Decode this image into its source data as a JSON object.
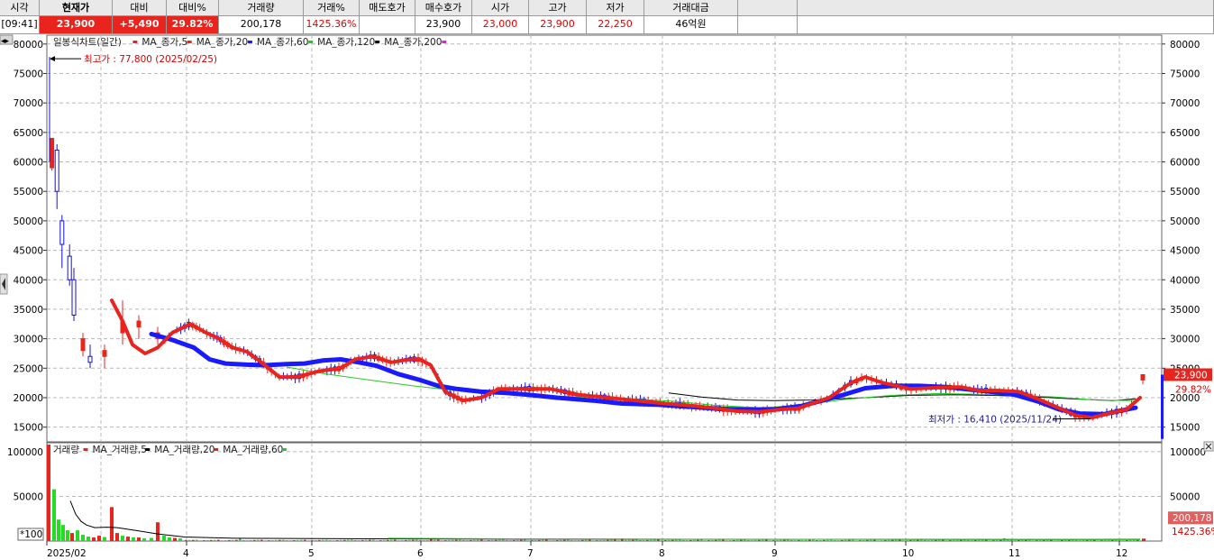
{
  "quote_header": {
    "labels": [
      "시각",
      "현재가",
      "대비",
      "대비%",
      "거래량",
      "거래%",
      "매도호가",
      "매수호가",
      "시가",
      "고가",
      "저가",
      "거래대금"
    ],
    "values": [
      "[09:41]",
      "23,900",
      "+5,490",
      "29.82%",
      "200,178",
      "1425.36%",
      "",
      "23,900",
      "23,000",
      "23,900",
      "22,250",
      "46억원"
    ]
  },
  "price_panel": {
    "legend": [
      "일봉식차트(일간)",
      "MA_종가,5",
      "MA_종가,20",
      "MA_종가,60",
      "MA_종가,120",
      "MA_종가,200"
    ],
    "high_annotation": "최고가 : 77,800 (2025/02/25)",
    "low_annotation": "최저가 : 16,410 (2025/11/24)",
    "price_tag": "23,900",
    "pct_tag": "29.82%",
    "expand_glyph": "◂▸"
  },
  "volume_panel": {
    "legend": [
      "거래량",
      "MA_거래량,5",
      "MA_거래량,20",
      "MA_거래량,60"
    ],
    "volume_tag": "200,178",
    "pct_tag": "1425.36%",
    "scale_label": "*100"
  },
  "colors": {
    "up": "#e8241c",
    "down": "#1010e0",
    "ma5": "#e8241c",
    "ma20": "#1a1aff",
    "ma120": "#22cc22",
    "ma200": "#000000",
    "vol_up": "#e8241c",
    "vol_down": "#22dd22"
  },
  "chart_data": {
    "type": "candlestick",
    "price_axis": {
      "ticks": [
        15000,
        20000,
        25000,
        30000,
        35000,
        40000,
        45000,
        50000,
        55000,
        60000,
        65000,
        70000,
        75000,
        80000
      ],
      "ylim": [
        12500,
        81500
      ]
    },
    "volume_axis": {
      "ticks": [
        50000,
        100000
      ],
      "ylim": [
        0,
        110000
      ]
    },
    "x_labels": [
      "2025/02",
      "4",
      "5",
      "6",
      "7",
      "8",
      "9",
      "10",
      "11",
      "12"
    ],
    "ma20_series": [
      [
        3.3,
        36500
      ],
      [
        3.45,
        33000
      ],
      [
        3.6,
        29000
      ],
      [
        3.8,
        27500
      ],
      [
        4.0,
        28500
      ],
      [
        4.2,
        31000
      ],
      [
        4.45,
        32500
      ],
      [
        4.7,
        31000
      ],
      [
        4.9,
        30000
      ],
      [
        5.1,
        28500
      ],
      [
        5.3,
        27800
      ],
      [
        5.5,
        26000
      ],
      [
        5.75,
        23500
      ],
      [
        6.0,
        23500
      ],
      [
        6.3,
        24500
      ],
      [
        6.6,
        25000
      ],
      [
        6.8,
        26500
      ],
      [
        7.05,
        27000
      ],
      [
        7.3,
        26000
      ],
      [
        7.55,
        26500
      ],
      [
        7.7,
        26500
      ],
      [
        7.85,
        25500
      ],
      [
        8.05,
        21000
      ],
      [
        8.3,
        19500
      ],
      [
        8.55,
        20000
      ],
      [
        8.8,
        21500
      ],
      [
        9.1,
        21500
      ],
      [
        9.5,
        21500
      ],
      [
        9.9,
        20500
      ],
      [
        10.3,
        20000
      ],
      [
        10.7,
        19500
      ],
      [
        11.1,
        19000
      ],
      [
        11.5,
        18600
      ],
      [
        11.8,
        18200
      ],
      [
        12.1,
        17700
      ],
      [
        12.4,
        17600
      ],
      [
        12.7,
        18000
      ],
      [
        12.95,
        18200
      ],
      [
        13.25,
        20000
      ],
      [
        13.45,
        22500
      ],
      [
        13.6,
        23500
      ],
      [
        13.8,
        22500
      ],
      [
        14.1,
        21500
      ],
      [
        14.4,
        21700
      ],
      [
        14.7,
        21800
      ],
      [
        14.95,
        21200
      ],
      [
        15.2,
        21200
      ],
      [
        15.45,
        21000
      ],
      [
        15.7,
        19700
      ],
      [
        15.95,
        18200
      ],
      [
        16.15,
        17000
      ],
      [
        16.35,
        16600
      ],
      [
        16.55,
        17300
      ],
      [
        16.75,
        18000
      ],
      [
        16.9,
        20000
      ]
    ],
    "ma60_series": [
      [
        3.9,
        30800
      ],
      [
        4.2,
        29800
      ],
      [
        4.5,
        28500
      ],
      [
        4.75,
        26500
      ],
      [
        5.0,
        25800
      ],
      [
        5.3,
        25600
      ],
      [
        5.55,
        25500
      ],
      [
        5.85,
        25700
      ],
      [
        6.1,
        25800
      ],
      [
        6.35,
        26300
      ],
      [
        6.6,
        26500
      ],
      [
        6.85,
        26000
      ],
      [
        7.1,
        25400
      ],
      [
        7.4,
        24000
      ],
      [
        7.7,
        23000
      ],
      [
        7.95,
        22000
      ],
      [
        8.2,
        21500
      ],
      [
        8.55,
        21000
      ],
      [
        8.9,
        20800
      ],
      [
        9.2,
        20500
      ],
      [
        9.6,
        20000
      ],
      [
        10.1,
        19500
      ],
      [
        10.5,
        19000
      ],
      [
        11.0,
        18800
      ],
      [
        11.5,
        18400
      ],
      [
        11.85,
        18100
      ],
      [
        12.2,
        18000
      ],
      [
        12.6,
        18000
      ],
      [
        13.0,
        18600
      ],
      [
        13.35,
        20300
      ],
      [
        13.6,
        21600
      ],
      [
        13.9,
        22000
      ],
      [
        14.2,
        22000
      ],
      [
        14.5,
        21800
      ],
      [
        14.8,
        21400
      ],
      [
        15.1,
        21000
      ],
      [
        15.4,
        20500
      ],
      [
        15.7,
        19300
      ],
      [
        15.95,
        18000
      ],
      [
        16.2,
        17300
      ],
      [
        16.5,
        17200
      ],
      [
        16.75,
        18000
      ],
      [
        16.85,
        18300
      ]
    ],
    "ma120_series": [
      [
        5.85,
        25200
      ],
      [
        6.4,
        24000
      ],
      [
        7.0,
        23000
      ],
      [
        7.6,
        22000
      ],
      [
        8.2,
        21200
      ],
      [
        8.8,
        20700
      ],
      [
        9.4,
        20300
      ],
      [
        10.0,
        20100
      ],
      [
        10.6,
        19800
      ],
      [
        11.2,
        19400
      ],
      [
        11.8,
        18700
      ],
      [
        12.4,
        18300
      ],
      [
        12.9,
        18600
      ],
      [
        13.4,
        19700
      ],
      [
        13.9,
        20400
      ],
      [
        14.4,
        20700
      ],
      [
        14.9,
        20600
      ],
      [
        15.4,
        20400
      ],
      [
        15.9,
        20100
      ],
      [
        16.4,
        19600
      ],
      [
        16.85,
        19500
      ]
    ],
    "ma200_series": [
      [
        11.15,
        20800
      ],
      [
        11.6,
        20100
      ],
      [
        12.1,
        19600
      ],
      [
        12.6,
        19500
      ],
      [
        13.1,
        19600
      ],
      [
        13.6,
        20000
      ],
      [
        14.1,
        20400
      ],
      [
        14.6,
        20500
      ],
      [
        15.1,
        20400
      ],
      [
        15.6,
        20200
      ],
      [
        16.1,
        19800
      ],
      [
        16.6,
        19500
      ],
      [
        16.85,
        19800
      ]
    ],
    "candles_sample": [
      [
        2.1,
        59000,
        64000,
        58500,
        64000
      ],
      [
        2.2,
        62000,
        63000,
        52000,
        55000
      ],
      [
        2.3,
        50000,
        51000,
        42000,
        46000
      ],
      [
        2.45,
        44000,
        46000,
        39000,
        40000
      ],
      [
        2.55,
        40000,
        42000,
        33000,
        34000
      ],
      [
        2.8,
        28000,
        31000,
        27000,
        30000
      ],
      [
        3.0,
        27000,
        29000,
        25000,
        26000
      ],
      [
        3.2,
        27000,
        29000,
        25000,
        28000
      ],
      [
        3.45,
        31000,
        36500,
        29000,
        33000
      ],
      [
        3.7,
        32000,
        34000,
        30000,
        33000
      ],
      [
        4.0,
        30000,
        32000,
        29000,
        31000
      ]
    ],
    "current_candle": {
      "open": 23000,
      "high": 23900,
      "low": 22250,
      "close": 23900
    },
    "current_volume": 200178
  }
}
